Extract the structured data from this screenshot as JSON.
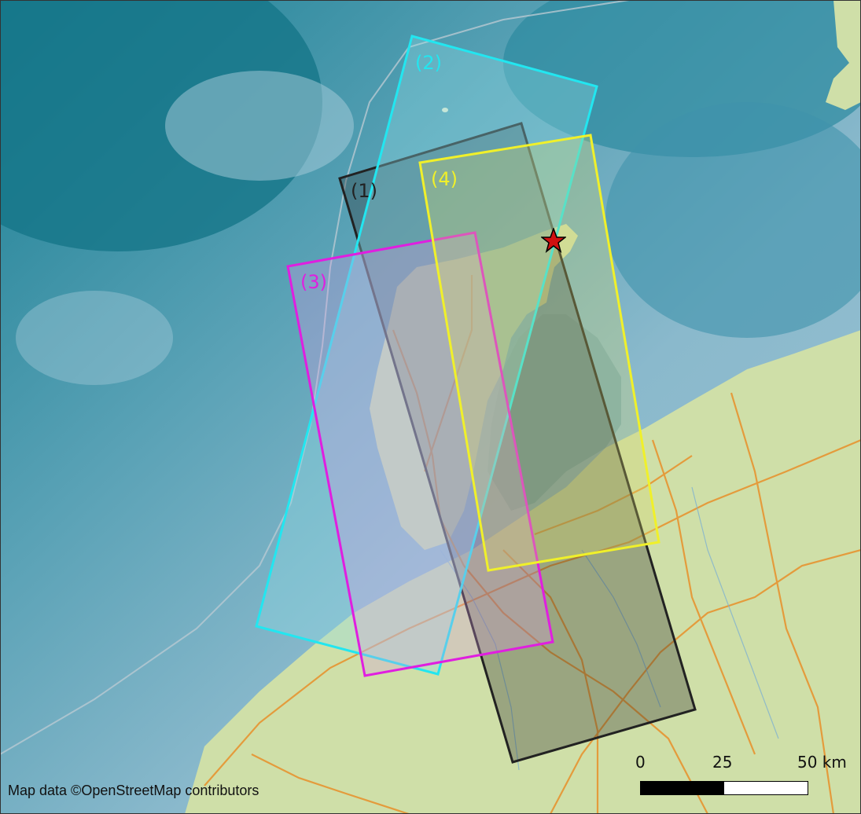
{
  "map": {
    "attribution": "Map data ©OpenStreetMap contributors",
    "scale_bar": {
      "ticks": [
        "0",
        "25",
        "50 km"
      ]
    },
    "footprints": [
      {
        "label": "(1)",
        "color": "#222222"
      },
      {
        "label": "(2)",
        "color": "#22e6f0"
      },
      {
        "label": "(3)",
        "color": "#e01ee0"
      },
      {
        "label": "(4)",
        "color": "#f0f02a"
      }
    ],
    "epicenter": {
      "icon": "star-icon",
      "color": "#d01010"
    },
    "colors": {
      "deep_sea": "#1a7f93",
      "shallow_sea": "#8ab9cc",
      "land": "#cfdfa8",
      "roads": "#e8902a"
    }
  }
}
